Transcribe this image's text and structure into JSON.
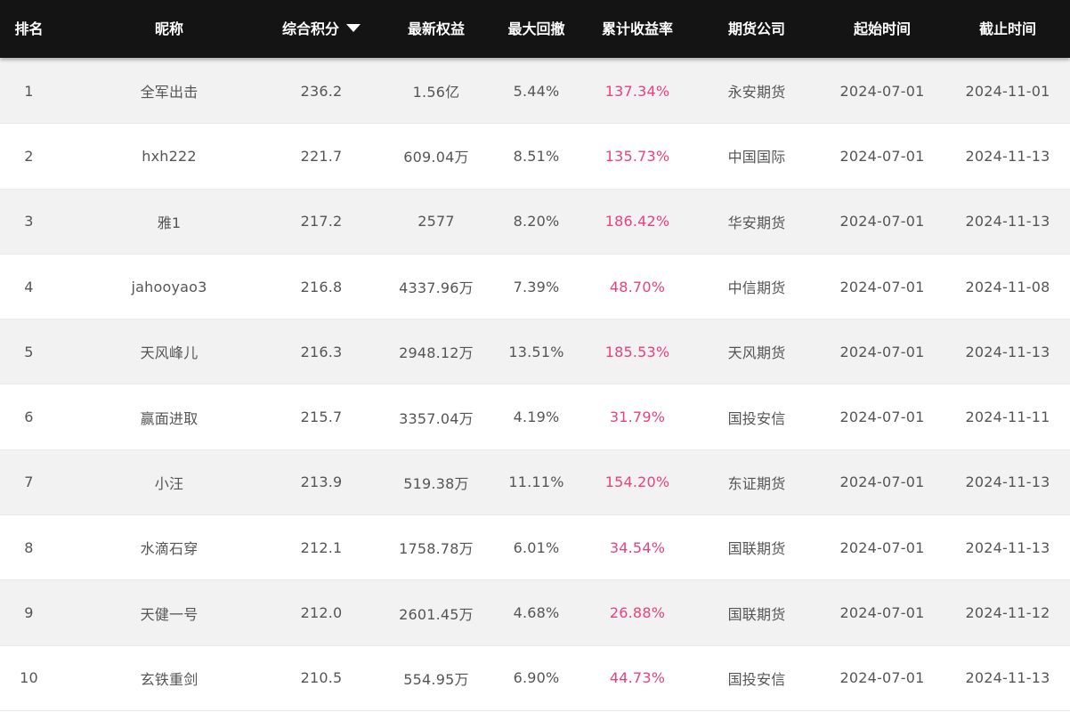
{
  "header": {
    "rank": "排名",
    "nickname": "昵称",
    "score": "综合积分",
    "equity": "最新权益",
    "max_drawdown": "最大回撤",
    "cumulative_return": "累计收益率",
    "company": "期货公司",
    "start_time": "起始时间",
    "end_time": "截止时间",
    "sort_icon": "caret-down-icon"
  },
  "colors": {
    "header_bg": "#141414",
    "row_alt_bg": "#f2f2f2",
    "return_color": "#e8417f",
    "text_color": "#555555"
  },
  "rows": [
    {
      "rank": "1",
      "nickname": "全军出击",
      "score": "236.2",
      "equity": "1.56亿",
      "max_drawdown": "5.44%",
      "cumulative_return": "137.34%",
      "company": "永安期货",
      "start_time": "2024-07-01",
      "end_time": "2024-11-01"
    },
    {
      "rank": "2",
      "nickname": "hxh222",
      "score": "221.7",
      "equity": "609.04万",
      "max_drawdown": "8.51%",
      "cumulative_return": "135.73%",
      "company": "中国国际",
      "start_time": "2024-07-01",
      "end_time": "2024-11-13"
    },
    {
      "rank": "3",
      "nickname": "雅1",
      "score": "217.2",
      "equity": "2577",
      "max_drawdown": "8.20%",
      "cumulative_return": "186.42%",
      "company": "华安期货",
      "start_time": "2024-07-01",
      "end_time": "2024-11-13"
    },
    {
      "rank": "4",
      "nickname": "jahooyao3",
      "score": "216.8",
      "equity": "4337.96万",
      "max_drawdown": "7.39%",
      "cumulative_return": "48.70%",
      "company": "中信期货",
      "start_time": "2024-07-01",
      "end_time": "2024-11-08"
    },
    {
      "rank": "5",
      "nickname": "天风峰儿",
      "score": "216.3",
      "equity": "2948.12万",
      "max_drawdown": "13.51%",
      "cumulative_return": "185.53%",
      "company": "天风期货",
      "start_time": "2024-07-01",
      "end_time": "2024-11-13"
    },
    {
      "rank": "6",
      "nickname": "赢面进取",
      "score": "215.7",
      "equity": "3357.04万",
      "max_drawdown": "4.19%",
      "cumulative_return": "31.79%",
      "company": "国投安信",
      "start_time": "2024-07-01",
      "end_time": "2024-11-11"
    },
    {
      "rank": "7",
      "nickname": "小汪",
      "score": "213.9",
      "equity": "519.38万",
      "max_drawdown": "11.11%",
      "cumulative_return": "154.20%",
      "company": "东证期货",
      "start_time": "2024-07-01",
      "end_time": "2024-11-13"
    },
    {
      "rank": "8",
      "nickname": "水滴石穿",
      "score": "212.1",
      "equity": "1758.78万",
      "max_drawdown": "6.01%",
      "cumulative_return": "34.54%",
      "company": "国联期货",
      "start_time": "2024-07-01",
      "end_time": "2024-11-13"
    },
    {
      "rank": "9",
      "nickname": "天健一号",
      "score": "212.0",
      "equity": "2601.45万",
      "max_drawdown": "4.68%",
      "cumulative_return": "26.88%",
      "company": "国联期货",
      "start_time": "2024-07-01",
      "end_time": "2024-11-12"
    },
    {
      "rank": "10",
      "nickname": "玄铁重剑",
      "score": "210.5",
      "equity": "554.95万",
      "max_drawdown": "6.90%",
      "cumulative_return": "44.73%",
      "company": "国投安信",
      "start_time": "2024-07-01",
      "end_time": "2024-11-13"
    }
  ]
}
